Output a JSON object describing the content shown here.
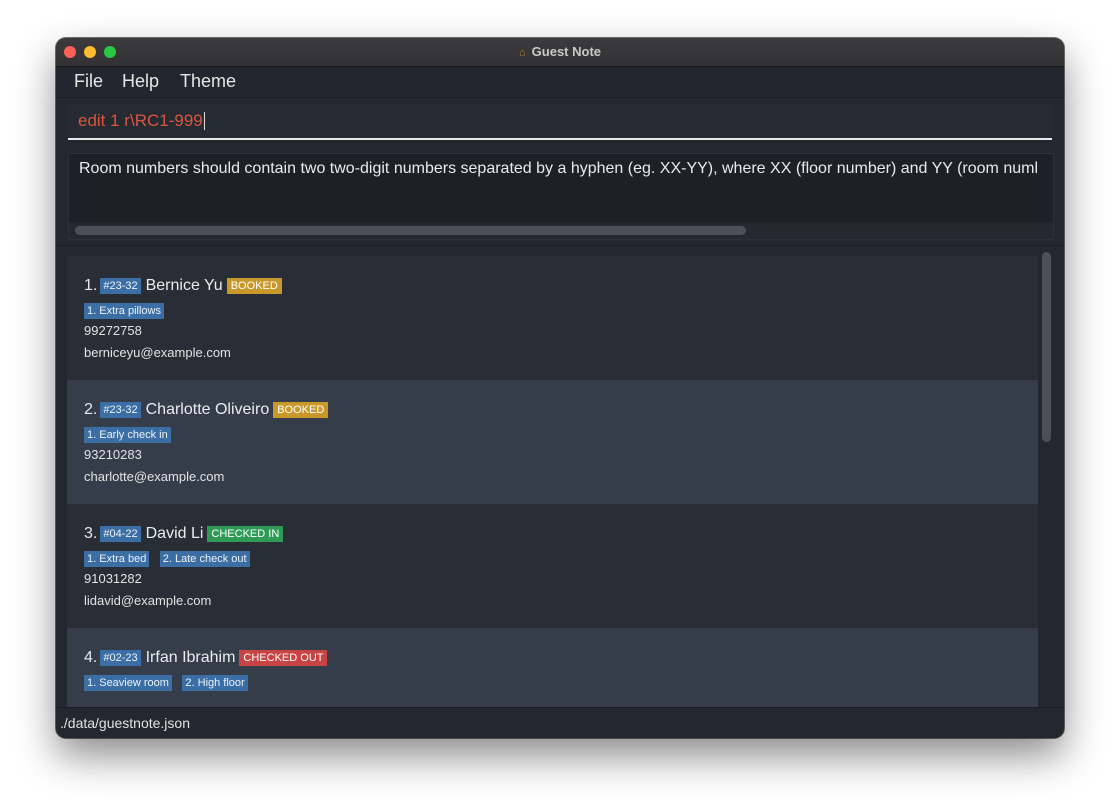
{
  "window": {
    "title": "Guest Note"
  },
  "menu": {
    "file": "File",
    "help": "Help",
    "theme": "Theme"
  },
  "command": {
    "value": "edit 1 r\\RC1-999"
  },
  "result": {
    "message": "Room numbers should contain two two-digit numbers separated by a hyphen (eg. XX-YY), where XX (floor number) and YY (room numl"
  },
  "guests": [
    {
      "index": "1.",
      "room": "#23-32",
      "name": "Bernice Yu",
      "status": "BOOKED",
      "requests": [
        "1. Extra pillows"
      ],
      "phone": "99272758",
      "email": "berniceyu@example.com"
    },
    {
      "index": "2.",
      "room": "#23-32",
      "name": "Charlotte Oliveiro",
      "status": "BOOKED",
      "requests": [
        "1. Early check in"
      ],
      "phone": "93210283",
      "email": "charlotte@example.com"
    },
    {
      "index": "3.",
      "room": "#04-22",
      "name": "David Li",
      "status": "CHECKED IN",
      "requests": [
        "1. Extra bed",
        "2. Late check out"
      ],
      "phone": "91031282",
      "email": "lidavid@example.com"
    },
    {
      "index": "4.",
      "room": "#02-23",
      "name": "Irfan Ibrahim",
      "status": "CHECKED OUT",
      "requests": [
        "1. Seaview room",
        "2. High floor"
      ],
      "phone": "",
      "email": ""
    }
  ],
  "status_bar": {
    "path": "./data/guestnote.json"
  },
  "colors": {
    "booked": "#c9982b",
    "checked_in": "#2e9a56",
    "checked_out": "#c84343",
    "tag": "#3a6ea5",
    "error_text": "#d9563f"
  }
}
